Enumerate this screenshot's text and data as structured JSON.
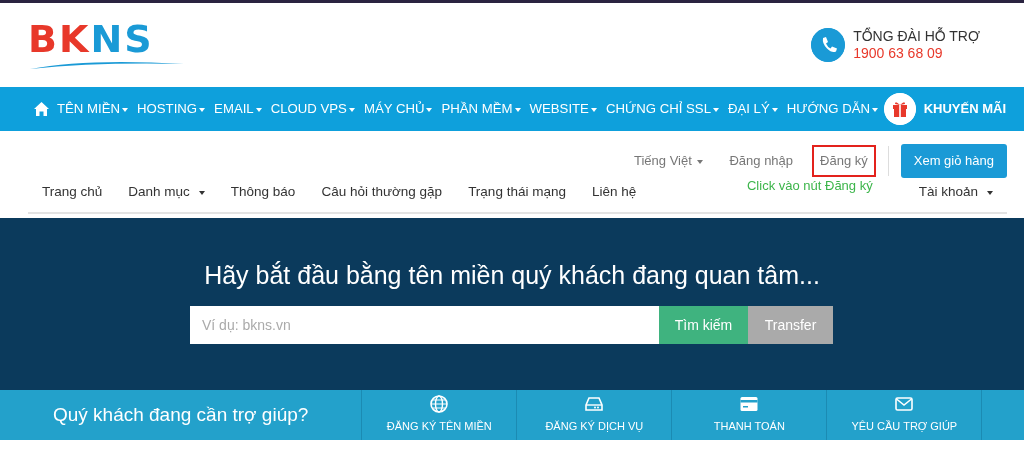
{
  "logo": {
    "text": "BKNS"
  },
  "hotline": {
    "label": "TỔNG ĐÀI HỖ TRỢ",
    "number": "1900 63 68 09"
  },
  "main_nav": {
    "items": [
      {
        "label": "TÊN MIỀN",
        "dropdown": true
      },
      {
        "label": "HOSTING",
        "dropdown": true
      },
      {
        "label": "EMAIL",
        "dropdown": true
      },
      {
        "label": "CLOUD VPS",
        "dropdown": true
      },
      {
        "label": "MÁY CHỦ",
        "dropdown": true
      },
      {
        "label": "PHẦN MỀM",
        "dropdown": true
      },
      {
        "label": "WEBSITE",
        "dropdown": true
      },
      {
        "label": "CHỨNG CHỈ SSL",
        "dropdown": true
      },
      {
        "label": "ĐẠI LÝ",
        "dropdown": true
      },
      {
        "label": "HƯỚNG DẪN",
        "dropdown": true
      }
    ],
    "promo": "KHUYẾN MÃI"
  },
  "account_links": [
    {
      "label": "Tiếng Việt",
      "dropdown": true,
      "highlighted": false
    },
    {
      "label": "Đăng nhập",
      "dropdown": false,
      "highlighted": false
    },
    {
      "label": "Đăng ký",
      "dropdown": false,
      "highlighted": true
    }
  ],
  "cart_button": "Xem giỏ hàng",
  "annotation": "Click vào nút Đăng ký",
  "sub_nav": {
    "items": [
      {
        "label": "Trang chủ",
        "dropdown": false
      },
      {
        "label": "Danh mục",
        "dropdown": true
      },
      {
        "label": "Thông báo",
        "dropdown": false
      },
      {
        "label": "Câu hỏi thường gặp",
        "dropdown": false
      },
      {
        "label": "Trạng thái mạng",
        "dropdown": false
      },
      {
        "label": "Liên hệ",
        "dropdown": false
      }
    ],
    "account": {
      "label": "Tài khoản",
      "dropdown": true
    }
  },
  "hero": {
    "title": "Hãy bắt đầu bằng tên miền quý khách đang quan tâm...",
    "placeholder": "Ví dụ: bkns.vn",
    "search_button": "Tìm kiếm",
    "transfer_button": "Transfer"
  },
  "help_bar": {
    "title": "Quý khách đang cần trợ giúp?",
    "items": [
      {
        "kind": "globe",
        "label": "ĐĂNG KÝ TÊN MIỀN"
      },
      {
        "kind": "drive",
        "label": "ĐĂNG KÝ DỊCH VỤ"
      },
      {
        "kind": "card",
        "label": "THANH TOÁN"
      },
      {
        "kind": "mail",
        "label": "YÊU CẦU TRỢ GIÚP"
      }
    ]
  }
}
